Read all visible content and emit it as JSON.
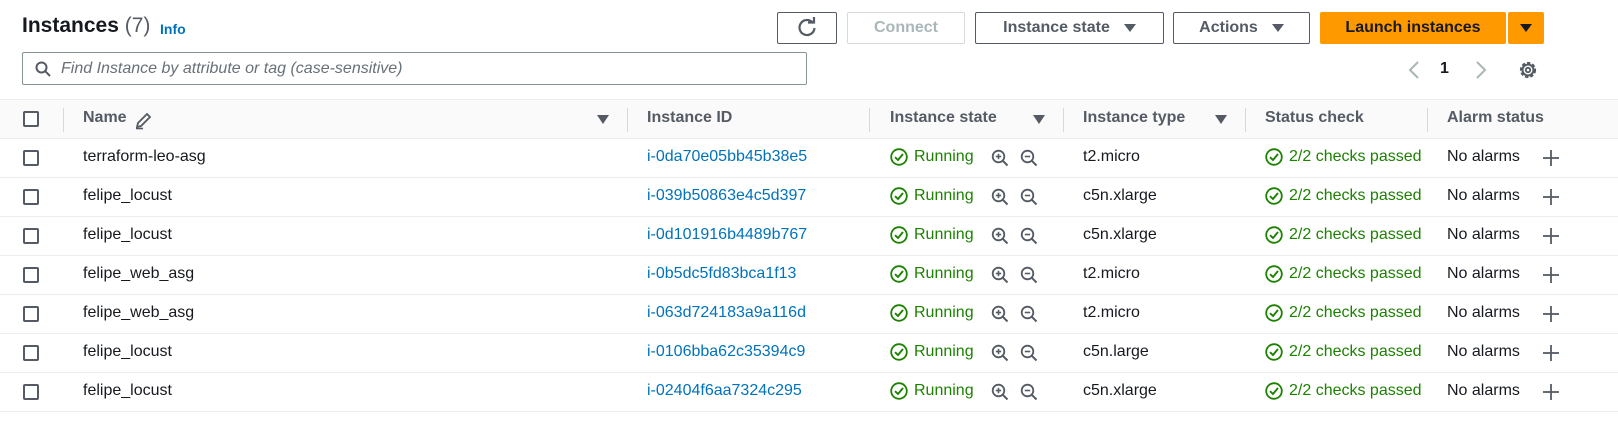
{
  "header": {
    "title": "Instances",
    "count": "(7)",
    "info": "Info",
    "connect": "Connect",
    "instance_state": "Instance state",
    "actions": "Actions",
    "launch": "Launch instances"
  },
  "search": {
    "placeholder": "Find Instance by attribute or tag (case-sensitive)"
  },
  "pagination": {
    "page": "1"
  },
  "columns": {
    "name": "Name",
    "instance_id": "Instance ID",
    "instance_state": "Instance state",
    "instance_type": "Instance type",
    "status_check": "Status check",
    "alarm_status": "Alarm status"
  },
  "rows": [
    {
      "name": "terraform-leo-asg",
      "id": "i-0da70e05bb45b38e5",
      "state": "Running",
      "type": "t2.micro",
      "status": "2/2 checks passed",
      "alarm": "No alarms"
    },
    {
      "name": "felipe_locust",
      "id": "i-039b50863e4c5d397",
      "state": "Running",
      "type": "c5n.xlarge",
      "status": "2/2 checks passed",
      "alarm": "No alarms"
    },
    {
      "name": "felipe_locust",
      "id": "i-0d101916b4489b767",
      "state": "Running",
      "type": "c5n.xlarge",
      "status": "2/2 checks passed",
      "alarm": "No alarms"
    },
    {
      "name": "felipe_web_asg",
      "id": "i-0b5dc5fd83bca1f13",
      "state": "Running",
      "type": "t2.micro",
      "status": "2/2 checks passed",
      "alarm": "No alarms"
    },
    {
      "name": "felipe_web_asg",
      "id": "i-063d724183a9a116d",
      "state": "Running",
      "type": "t2.micro",
      "status": "2/2 checks passed",
      "alarm": "No alarms"
    },
    {
      "name": "felipe_locust",
      "id": "i-0106bba62c35394c9",
      "state": "Running",
      "type": "c5n.large",
      "status": "2/2 checks passed",
      "alarm": "No alarms"
    },
    {
      "name": "felipe_locust",
      "id": "i-02404f6aa7324c295",
      "state": "Running",
      "type": "c5n.xlarge",
      "status": "2/2 checks passed",
      "alarm": "No alarms"
    }
  ],
  "colors": {
    "primary": "#ff9900",
    "link": "#0073bb",
    "success": "#1d8102",
    "text": "#16191f",
    "muted": "#545b64"
  },
  "icons": [
    "refresh-icon",
    "search-icon",
    "chevron-left-icon",
    "chevron-right-icon",
    "settings-icon",
    "edit-icon",
    "check-circle-icon",
    "zoom-in-icon",
    "zoom-out-icon",
    "plus-icon"
  ]
}
